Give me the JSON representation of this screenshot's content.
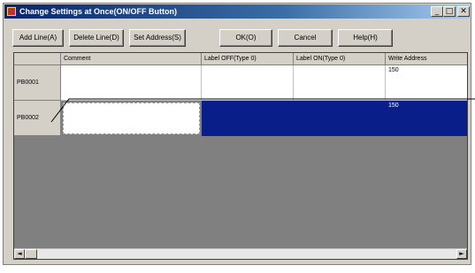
{
  "window": {
    "title": "Change Settings at Once(ON/OFF Button)",
    "controls": {
      "minimize": "_",
      "maximize": "□",
      "close": "✕"
    }
  },
  "toolbar": {
    "add_line": "Add Line(A)",
    "delete_line": "Delete Line(D)",
    "set_address": "Set Address(S)",
    "ok": "OK(O)",
    "cancel": "Cancel",
    "help": "Help(H)"
  },
  "table": {
    "columns": [
      "",
      "Comment",
      "Label OFF(Type 0)",
      "Label ON(Type 0)",
      "Write Address"
    ],
    "rows": [
      {
        "id": "PB0001",
        "comment": "",
        "label_off": "",
        "label_on": "",
        "write_address": "150"
      },
      {
        "id": "PB0002",
        "comment": "",
        "label_off": "",
        "label_on": "",
        "write_address": "150"
      }
    ]
  },
  "scrollbar": {
    "left_arrow": "◄",
    "right_arrow": "►"
  },
  "colors": {
    "selection": "#0a1e8a",
    "titlebar": "#0a246a",
    "face": "#d4d0c8"
  }
}
